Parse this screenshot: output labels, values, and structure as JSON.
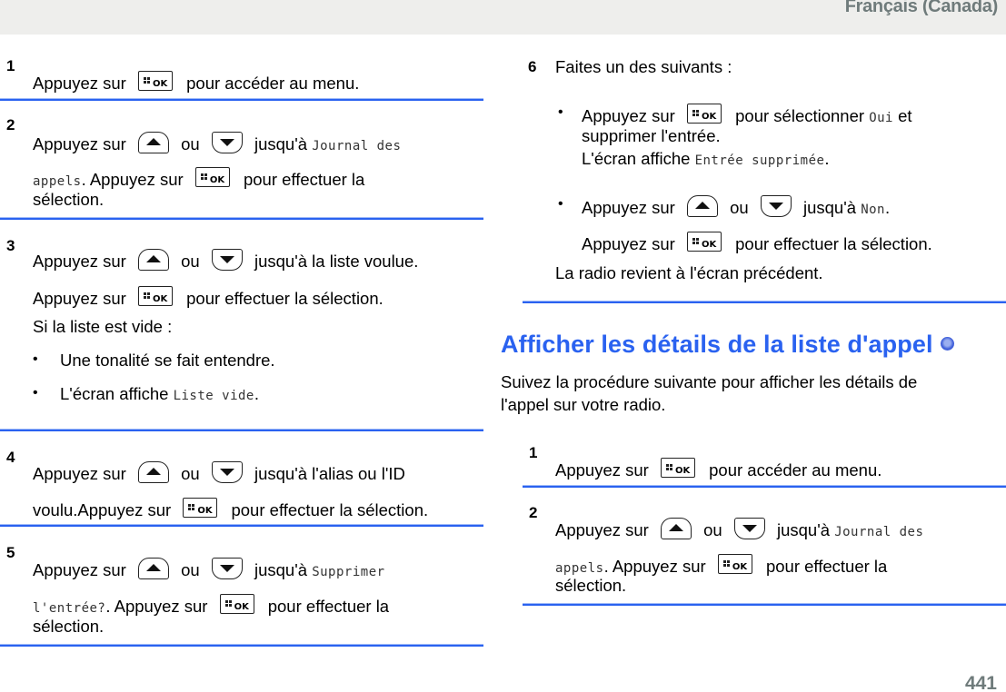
{
  "header": {
    "language": "Français (Canada)"
  },
  "footer": {
    "page_number": "441"
  },
  "keys": {
    "ok_label": "OK"
  },
  "left_column": {
    "step1": {
      "number": "1",
      "pre": "Appuyez sur",
      "post": "pour accéder au menu."
    },
    "step2": {
      "number": "2",
      "line1_pre": "Appuyez sur",
      "or": "ou",
      "line1_post": "jusqu'à",
      "line1_mono": "Journal des",
      "line2_mono": "appels",
      "line2_pre": ". Appuyez sur",
      "line2_post": "pour effectuer la",
      "line3": "sélection."
    },
    "step3": {
      "number": "3",
      "line1_pre": "Appuyez sur",
      "or": "ou",
      "line1_post": "jusqu'à la liste voulue.",
      "line2_pre": "Appuyez sur",
      "line2_post": "pour effectuer la sélection.",
      "line3": "Si la liste est vide :",
      "bullets": [
        {
          "text": "Une tonalité se fait entendre."
        },
        {
          "text": "L'écran affiche",
          "mono": "Liste vide",
          "tail": "."
        }
      ]
    },
    "step4": {
      "number": "4",
      "line1_pre": "Appuyez sur",
      "or": "ou",
      "line1_post": "jusqu'à l'alias ou l'ID",
      "line2_pre": "voulu.Appuyez sur",
      "line2_post": "pour effectuer la sélection."
    },
    "step5": {
      "number": "5",
      "line1_pre": "Appuyez sur",
      "or": "ou",
      "line1_post": "jusqu'à",
      "line1_mono": "Supprimer",
      "line2_mono": "l'entrée?",
      "line2_pre": ". Appuyez sur",
      "line2_post": "pour effectuer la",
      "line3": "sélection."
    }
  },
  "right_column": {
    "step6": {
      "number": "6",
      "intro": "Faites un des suivants :",
      "bullet1": {
        "pre": "Appuyez sur",
        "post": "pour sélectionner",
        "mono": "Oui",
        "tail": "et",
        "line2": "supprimer l'entrée.",
        "line3_pre": "L'écran affiche",
        "line3_mono": "Entrée supprimée",
        "line3_tail": "."
      },
      "bullet2": {
        "pre": "Appuyez sur",
        "or": "ou",
        "post": "jusqu'à",
        "mono": "Non",
        "tail": ".",
        "line2_pre": "Appuyez sur",
        "line2_post": "pour effectuer la sélection."
      },
      "outcome": "La radio revient à l'écran précédent."
    },
    "section": {
      "title": "Afficher les détails de la liste d'appel",
      "intro_line1": "Suivez la procédure suivante pour afficher les détails de",
      "intro_line2": "l'appel sur votre radio."
    },
    "step1": {
      "number": "1",
      "pre": "Appuyez sur",
      "post": "pour accéder au menu."
    },
    "step2": {
      "number": "2",
      "line1_pre": "Appuyez sur",
      "or": "ou",
      "line1_post": "jusqu'à",
      "line1_mono": "Journal des",
      "line2_mono": "appels",
      "line2_pre": ". Appuyez sur",
      "line2_post": "pour effectuer la",
      "line3": "sélection."
    }
  },
  "colors": {
    "accent": "#2a62f0",
    "header_bg": "#eeeeec",
    "header_text": "#6f7b7b"
  }
}
